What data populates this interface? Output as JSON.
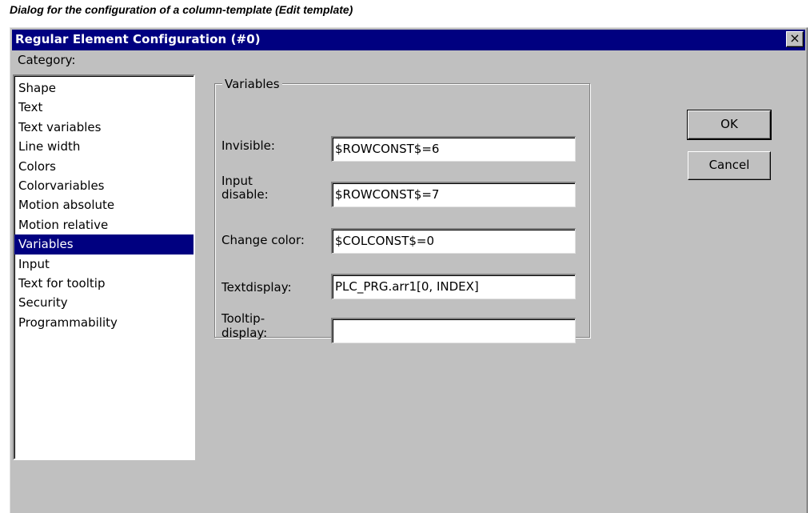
{
  "caption": "Dialog for the configuration of a column-template (Edit template)",
  "dialog": {
    "title": "Regular Element Configuration (#0)",
    "close_label": "×",
    "category_label": "Category:",
    "categories": [
      "Shape",
      "Text",
      "Text variables",
      "Line width",
      "Colors",
      "Colorvariables",
      "Motion absolute",
      "Motion relative",
      "Variables",
      "Input",
      "Text for tooltip",
      "Security",
      "Programmability"
    ],
    "selected_category": "Variables",
    "group_title": "Variables",
    "fields": {
      "invisible": {
        "label": "Invisible:",
        "value": "$ROWCONST$=6"
      },
      "input_disable": {
        "label_line1": "Input",
        "label_line2": "disable:",
        "value": "$ROWCONST$=7"
      },
      "change_color": {
        "label": "Change color:",
        "value": "$COLCONST$=0"
      },
      "textdisplay": {
        "label": "Textdisplay:",
        "value": "PLC_PRG.arr1[0, INDEX]"
      },
      "tooltip_display": {
        "label_line1": "Tooltip-",
        "label_line2": "display:",
        "value": ""
      }
    },
    "ok_label": "OK",
    "cancel_label": "Cancel"
  },
  "colors": {
    "titlebar": "#000080",
    "dialog_bg": "#c0c0c0",
    "selection": "#000080"
  }
}
